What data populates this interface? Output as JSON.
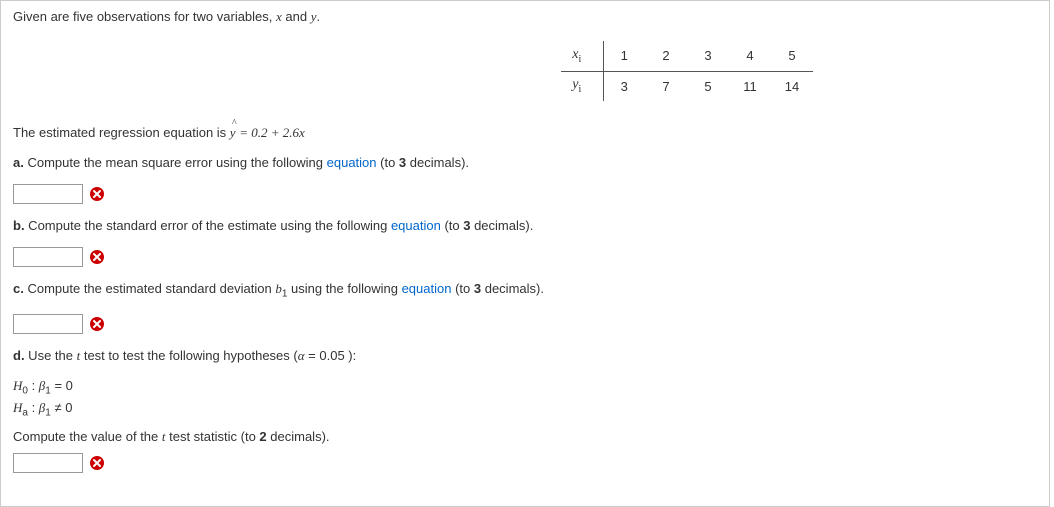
{
  "intro": "Given are five observations for two variables, x and y.",
  "table": {
    "xLabel": "xᵢ",
    "yLabel": "yᵢ",
    "x": [
      "1",
      "2",
      "3",
      "4",
      "5"
    ],
    "y": [
      "3",
      "7",
      "5",
      "11",
      "14"
    ]
  },
  "regression": {
    "prefix": "The estimated regression equation is ",
    "eq": "ŷ = 0.2 + 2.6x"
  },
  "parts": {
    "a": {
      "label": "a.",
      "text": " Compute the mean square error using the following ",
      "link": "equation",
      "suffix": " (to 3 decimals)."
    },
    "b": {
      "label": "b.",
      "text": " Compute the standard error of the estimate using the following ",
      "link": "equation",
      "suffix": " (to 3 decimals)."
    },
    "c": {
      "label": "c.",
      "text": " Compute the estimated standard deviation b₁ using the following ",
      "link": "equation",
      "suffix": " (to 3 decimals)."
    },
    "d": {
      "label": "d.",
      "text": " Use the t test to test the following hypotheses (α = 0.05 ):",
      "h0": "H₀ : β₁ = 0",
      "ha": "Hₐ : β₁ ≠ 0",
      "compute": "Compute the value of the t test statistic (to 2 decimals)."
    }
  }
}
